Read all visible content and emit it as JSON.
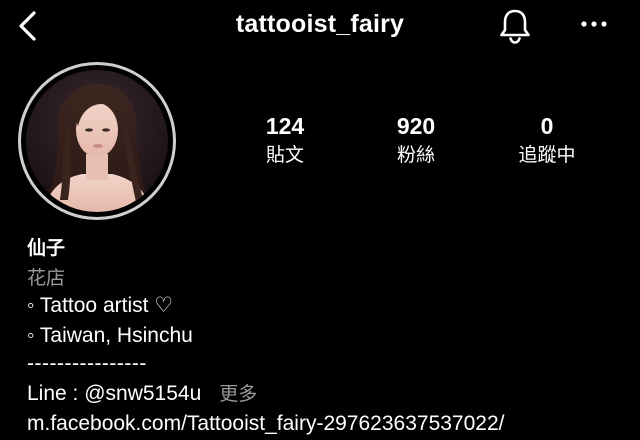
{
  "header": {
    "username": "tattooist_fairy",
    "back_icon": "chevron-left-icon",
    "bell_icon": "bell-icon",
    "more_icon": "more-horizontal-icon"
  },
  "profile": {
    "avatar_icon": "avatar",
    "stats": [
      {
        "value": "124",
        "label": "貼文"
      },
      {
        "value": "920",
        "label": "粉絲"
      },
      {
        "value": "0",
        "label": "追蹤中"
      }
    ],
    "display_name": "仙子",
    "category": "花店",
    "bio": {
      "line1": "◦ Tattoo artist ♡",
      "line2": "◦ Taiwan, Hsinchu",
      "divider": "----------------",
      "line3": "Line : @snw5154u",
      "more": "更多",
      "website": "m.facebook.com/Tattooist_fairy-297623637537022/"
    }
  },
  "colors": {
    "background": "#000000",
    "text": "#ffffff",
    "muted_text": "#9a9a9a",
    "avatar_ring": "#cfcfcf"
  }
}
